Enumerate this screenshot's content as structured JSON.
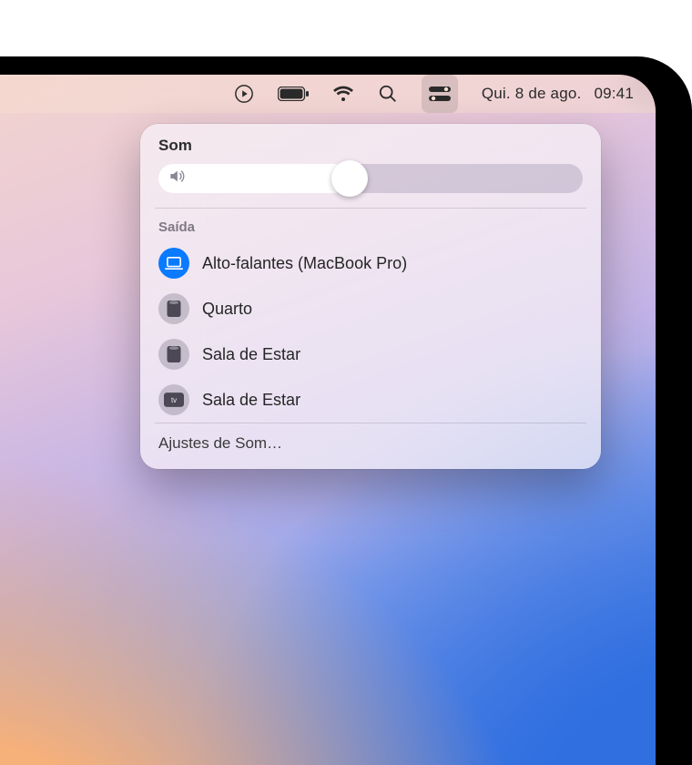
{
  "menubar": {
    "date": "Qui. 8 de ago.",
    "time": "09:41"
  },
  "panel": {
    "title": "Som",
    "volume_percent": 45,
    "output_section_label": "Saída",
    "outputs": [
      {
        "label": "Alto-falantes (MacBook Pro)",
        "icon": "laptop",
        "selected": true
      },
      {
        "label": "Quarto",
        "icon": "homepod",
        "selected": false
      },
      {
        "label": "Sala de Estar",
        "icon": "homepod",
        "selected": false
      },
      {
        "label": "Sala de Estar",
        "icon": "appletv",
        "selected": false
      }
    ],
    "settings_label": "Ajustes de Som…"
  },
  "colors": {
    "accent": "#0a7aff"
  }
}
